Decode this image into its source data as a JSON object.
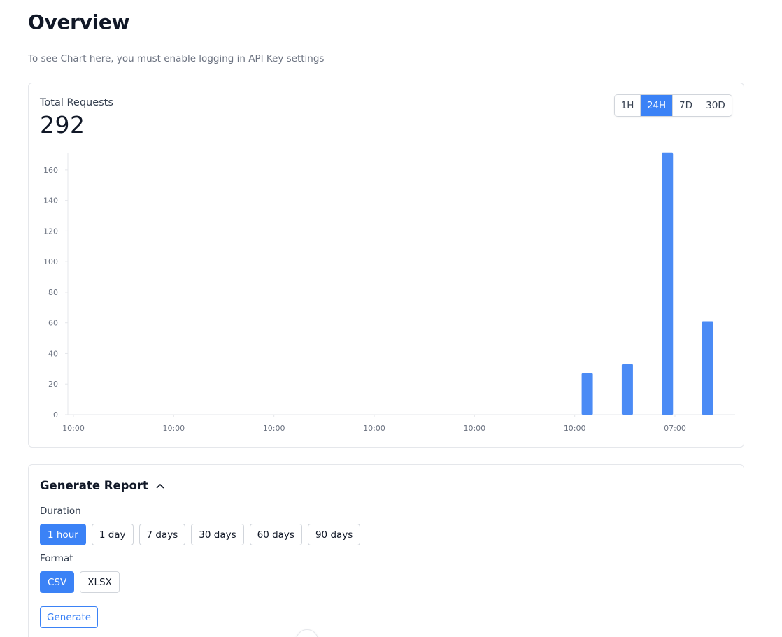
{
  "page": {
    "title": "Overview",
    "notice": "To see Chart here, you must enable logging in API Key settings"
  },
  "metrics": {
    "label": "Total Requests",
    "value": "292"
  },
  "range_selector": {
    "options": [
      "1H",
      "24H",
      "7D",
      "30D"
    ],
    "selected": "24H"
  },
  "colors": {
    "accent": "#3b82f6",
    "bar": "#4b8bf5",
    "axis": "#e5e7eb",
    "tick_text": "#6b7280"
  },
  "chart_data": {
    "type": "bar",
    "x_tick_labels": [
      "10:00",
      "10:00",
      "10:00",
      "10:00",
      "10:00",
      "10:00",
      "07:00"
    ],
    "y_ticks": [
      0,
      20,
      40,
      60,
      80,
      100,
      120,
      140,
      160
    ],
    "ylim": [
      0,
      170
    ],
    "bars": [
      {
        "slot": 20.5,
        "value": 27
      },
      {
        "slot": 22.1,
        "value": 33
      },
      {
        "slot": 23.7,
        "value": 171
      },
      {
        "slot": 25.3,
        "value": 61
      }
    ],
    "x_slots": 26.4,
    "grid": false,
    "legend": "none"
  },
  "report": {
    "title": "Generate Report",
    "duration_label": "Duration",
    "duration_options": [
      "1 hour",
      "1 day",
      "7 days",
      "30 days",
      "60 days",
      "90 days"
    ],
    "duration_selected": "1 hour",
    "format_label": "Format",
    "format_options": [
      "CSV",
      "XLSX"
    ],
    "format_selected": "CSV",
    "generate_label": "Generate"
  }
}
